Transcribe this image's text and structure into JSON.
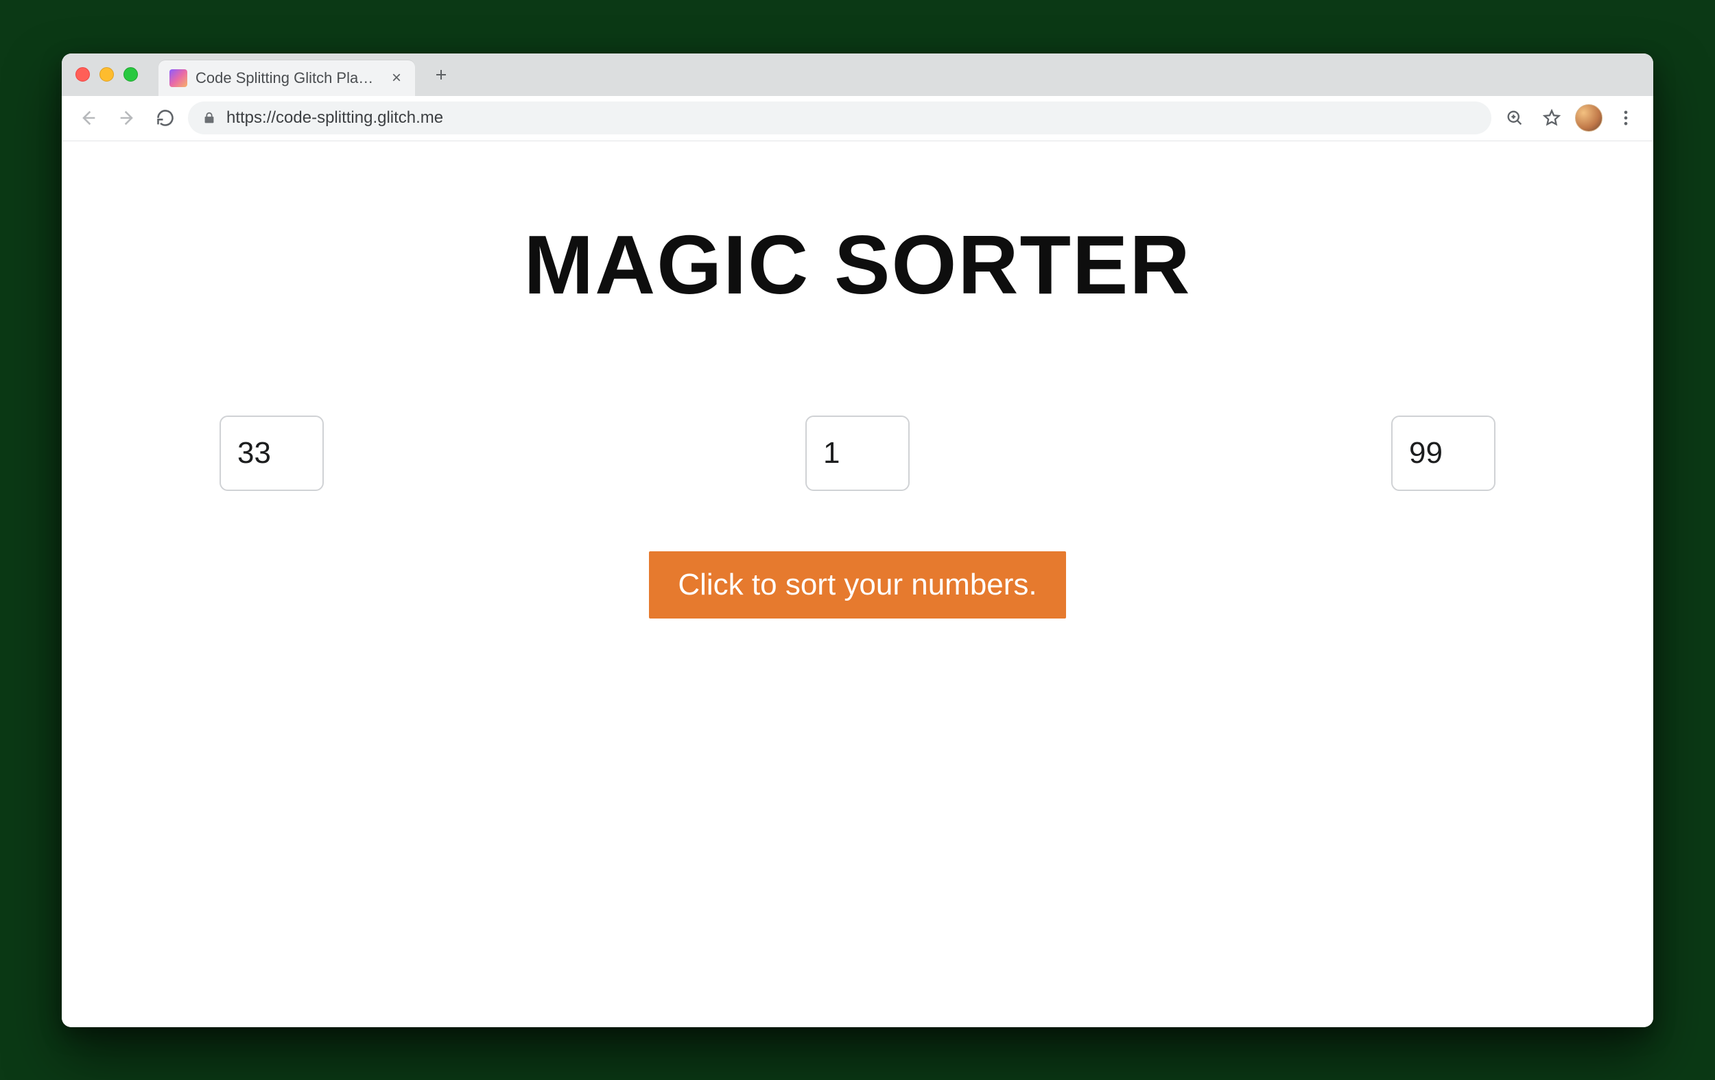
{
  "browser": {
    "tab_title": "Code Splitting Glitch Playgroun",
    "url": "https://code-splitting.glitch.me"
  },
  "page": {
    "heading": "MAGIC SORTER",
    "inputs": [
      "33",
      "1",
      "99"
    ],
    "button_label": "Click to sort your numbers."
  },
  "colors": {
    "accent": "#e67a2e"
  }
}
